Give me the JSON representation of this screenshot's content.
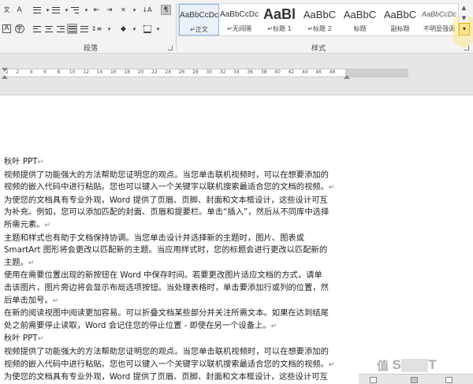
{
  "ribbon": {
    "paragraph_group_label": "段落",
    "styles_group_label": "样式",
    "styles": [
      {
        "preview": "AaBbCcDc",
        "name": "正文",
        "selected": true
      },
      {
        "preview": "AaBbCcDc",
        "name": "无间隔",
        "selected": false
      },
      {
        "preview": "AaBl",
        "name": "标题 1",
        "selected": false
      },
      {
        "preview": "AaBbC",
        "name": "标题 2",
        "selected": false
      },
      {
        "preview": "AaBbC",
        "name": "标题",
        "selected": false
      },
      {
        "preview": "AaBbC",
        "name": "副标题",
        "selected": false
      },
      {
        "preview": "AaBbCcDc",
        "name": "不明显强调",
        "selected": false
      }
    ],
    "icons": {
      "numbering": "numbered-list-icon",
      "sort": "sort-icon",
      "show_marks": "paragraph-mark-icon",
      "more_styles": "more-styles-icon"
    }
  },
  "ruler": {
    "ticks": [
      "2",
      "2",
      "4",
      "6",
      "8",
      "10",
      "12",
      "14",
      "16",
      "18",
      "20",
      "22",
      "24",
      "26",
      "28",
      "30",
      "32",
      "34",
      "36",
      "38",
      "40",
      "42",
      "44",
      "46",
      "48"
    ]
  },
  "document": {
    "paragraph_mark": "↵",
    "lines": [
      "秋叶 PPT",
      "视频提供了功能强大的方法帮助您证明您的观点。当您单击联机视频时，可以在想要添加的",
      "视频的嵌入代码中进行粘贴。您也可以键入一个关键字以联机搜索最适合您的文档的视频。",
      "为使您的文档具有专业外观，Word 提供了页眉、页脚、封面和文本框设计，这些设计可互",
      "为补充。例如，您可以添加匹配的封面、页眉和提要栏。单击“插入”，然后从不同库中选择",
      "所需元素。",
      "主题和样式也有助于文档保持协调。当您单击设计并选择新的主题时，图片、图表或",
      "SmartArt 图形将会更改以匹配新的主题。当应用样式时，您的标题会进行更改以匹配新的",
      "主题。",
      "使用在需要位置出现的新按钮在 Word 中保存时间。若要更改图片适应文档的方式，请单",
      "击该图片，图片旁边将会显示布局选项按钮。当处理表格时，单击要添加行或列的位置，然",
      "后单击加号。",
      "在新的阅读视图中阅读更加容易。可以折叠文档某些部分并关注所需文本。如果在达到结尾",
      "处之前需要停止读取，Word 会记住您的停止位置 - 即使在另一个设备上。",
      "秋叶 PPT",
      "视频提供了功能强大的方法帮助您证明您的观点。当您单击联机视频时，可以在想要添加的",
      "视频的嵌入代码中进行粘贴。您也可以键入一个关键字以联机搜索最适合您的文档的视频。",
      "为使您的文档具有专业外观，Word 提供了页眉、页脚、封面和文本框设计，这些设计可互"
    ],
    "marked_lines": [
      0,
      2,
      5,
      8,
      11,
      13,
      14,
      16
    ]
  },
  "watermark": {
    "left": "值",
    "letters": "S",
    "right": "T"
  }
}
